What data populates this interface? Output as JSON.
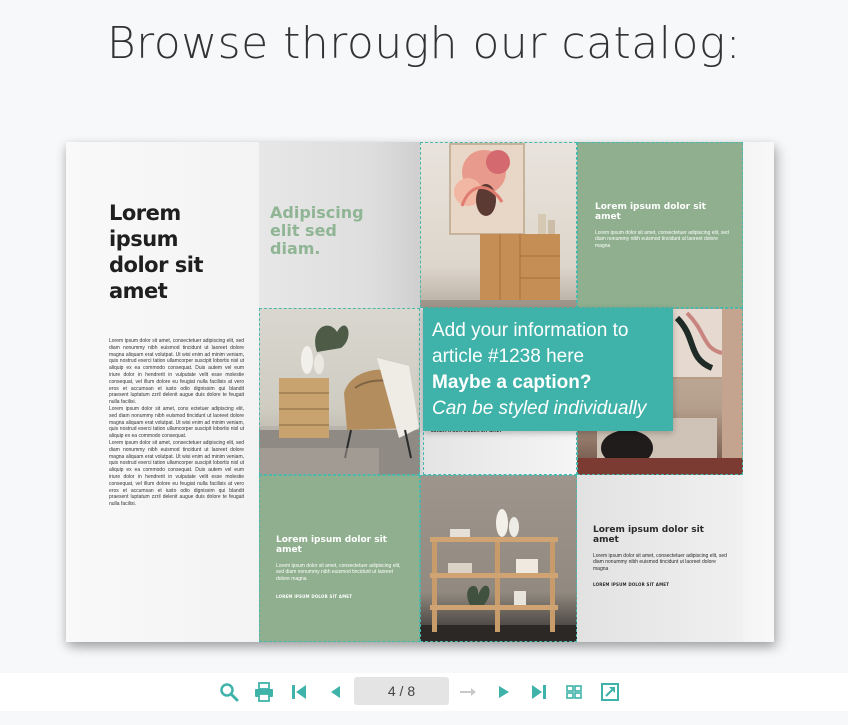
{
  "heading": "Browse through our catalog:",
  "left_page": {
    "title": "Lorem ipsum dolor sit amet",
    "paragraphs": [
      "Lorem ipsum dolor sit amet, consectetuer adipiscing elit, sed diam nonummy nibh euismod tincidunt ut laoreet dolore magna aliquam erat volutpat. Ut wisi enim ad minim veniam, quis nostrud exerci tation ullamcorper suscipit lobortis nisl ut aliquip ex ea commodo consequat. Duis autem vel eum iriure dolor in hendrerit in vulputate velit esse molestie consequat, vel illum dolore eu feugiat nulla facilisis at vero eros et accumsan et iusto odio dignissim qui blandit praesent luptatum zzril delenit augue duis dolore te feugait nulla facilisi.",
      "Lorem ipsum dolor sit amet, cons ectetuer adipiscing elit, sed diam nonummy nibh euismod tincidunt ut laoreet dolore magna aliquam erat volutpat. Ut wisi enim ad minim veniam, quis nostrud exerci tation ullamcorper suscipit lobortis nisl ut aliquip ex ea commodo consequat.",
      "Lorem ipsum dolor sit amet, consectetuer adipiscing elit, sed diam nonummy nibh euismod tincidunt ut laoreet dolore magna aliquam erat volutpat. Ut wisi enim ad minim veniam, quis nostrud exerci tation ullamcorper suscipit lobortis nisl ut aliquip ex ea commodo consequat. Duis autem vel eum iriure dolor in hendrerit in vulputate velit esse molestie consequat, vel illum dolore eu feugiat nulla facilisis at vero eros et accumsan et iusto odio dignissim qui blandit praesent luptatum zzril delenit augue duis dolore te feugait nulla facilisi."
    ],
    "green_heading": "Adipiscing elit sed diam.",
    "green_panel": {
      "title": "Lorem ipsum dolor sit amet",
      "text": "Lorem ipsum dolor sit amet, consectetuer adipiscing elit, sed diam nonummy nibh euismod tincidunt ut laoreet dolore magna",
      "foot": "LOREM IPSUM DOLOR SIT AMET"
    }
  },
  "right_page": {
    "green_panel": {
      "title": "Lorem ipsum dolor sit amet",
      "text": "Lorem ipsum dolor sit amet, consectetuer adipiscing elit, sed diam nonummy nibh euismod tincidunt ut laoreet dolore magna"
    },
    "hidden_label": "LOREM IPSUM DOLOR SIT AMET",
    "grey_panel": {
      "title": "Lorem ipsum dolor sit amet",
      "text": "Lorem ipsum dolor sit amet, consectetuer adipiscing elit, sed diam nonummy nibh euismod tincidunt ut laoreet dolore magna",
      "foot": "LOREM IPSUM DOLOR SIT AMET"
    }
  },
  "tooltip": {
    "line1": "Add your information to",
    "line2": "article #1238 here",
    "line3": "Maybe a caption?",
    "line4": "Can be styled individually"
  },
  "toolbar": {
    "page_indicator": "4 / 8",
    "buttons": [
      "zoom-icon",
      "print-icon",
      "first-page-icon",
      "previous-page-icon",
      "page-switch-icon",
      "next-page-icon",
      "last-page-icon",
      "thumbnails-icon",
      "fullscreen-icon"
    ],
    "accent": "#3fb3a9"
  },
  "colors": {
    "hotspot": "#4ab9ad",
    "panel_green": "#8faf8e",
    "heading_green": "#8fb595"
  }
}
